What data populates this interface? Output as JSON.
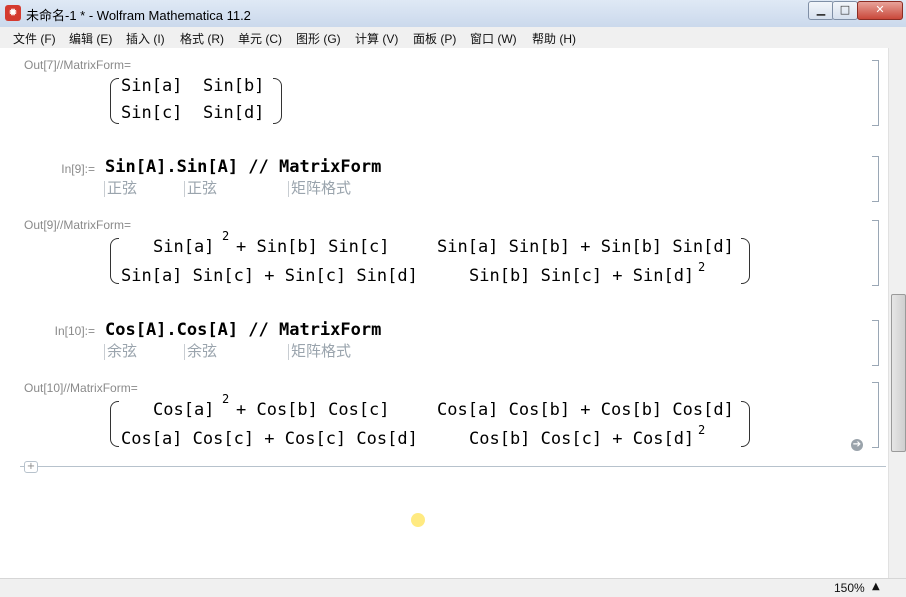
{
  "window": {
    "title": "未命名-1 * - Wolfram Mathematica 11.2",
    "app_icon": "mathematica-spikey-icon",
    "min_glyph": "▁",
    "max_glyph": "□",
    "close_glyph": "✕"
  },
  "menu": [
    "文件 (F)",
    "编辑 (E)",
    "插入 (I)",
    "格式 (R)",
    "单元 (C)",
    "图形 (G)",
    "计算 (V)",
    "面板 (P)",
    "窗口 (W)",
    "帮助 (H)"
  ],
  "cells": {
    "out7": {
      "label": "Out[7]//MatrixForm=",
      "rows": [
        [
          "Sin[a]",
          "Sin[b]"
        ],
        [
          "Sin[c]",
          "Sin[d]"
        ]
      ]
    },
    "in9": {
      "label": "In[9]:=",
      "code": "Sin[A].Sin[A] // MatrixForm",
      "hints": [
        "正弦",
        "正弦",
        "矩阵格式"
      ]
    },
    "out9": {
      "label": "Out[9]//MatrixForm=",
      "r1c1a": "Sin[a]",
      "r1c1b": "+ Sin[b] Sin[c]",
      "r1c2": "Sin[a] Sin[b] + Sin[b] Sin[d]",
      "r2c1": "Sin[a] Sin[c] + Sin[c] Sin[d]",
      "r2c2a": "Sin[b] Sin[c] + Sin[d]",
      "exp": "2"
    },
    "in10": {
      "label": "In[10]:=",
      "code": "Cos[A].Cos[A] // MatrixForm",
      "hints": [
        "余弦",
        "余弦",
        "矩阵格式"
      ]
    },
    "out10": {
      "label": "Out[10]//MatrixForm=",
      "r1c1a": "Cos[a]",
      "r1c1b": "+ Cos[b] Cos[c]",
      "r1c2": "Cos[a] Cos[b] + Cos[b] Cos[d]",
      "r2c1": "Cos[a] Cos[c] + Cos[c] Cos[d]",
      "r2c2a": "Cos[b] Cos[c] + Cos[d]",
      "exp": "2"
    }
  },
  "add_cell_glyph": "+",
  "suggestion_glyph": "➔",
  "status": {
    "zoom": "150%",
    "zoom_arrow": "▲"
  }
}
